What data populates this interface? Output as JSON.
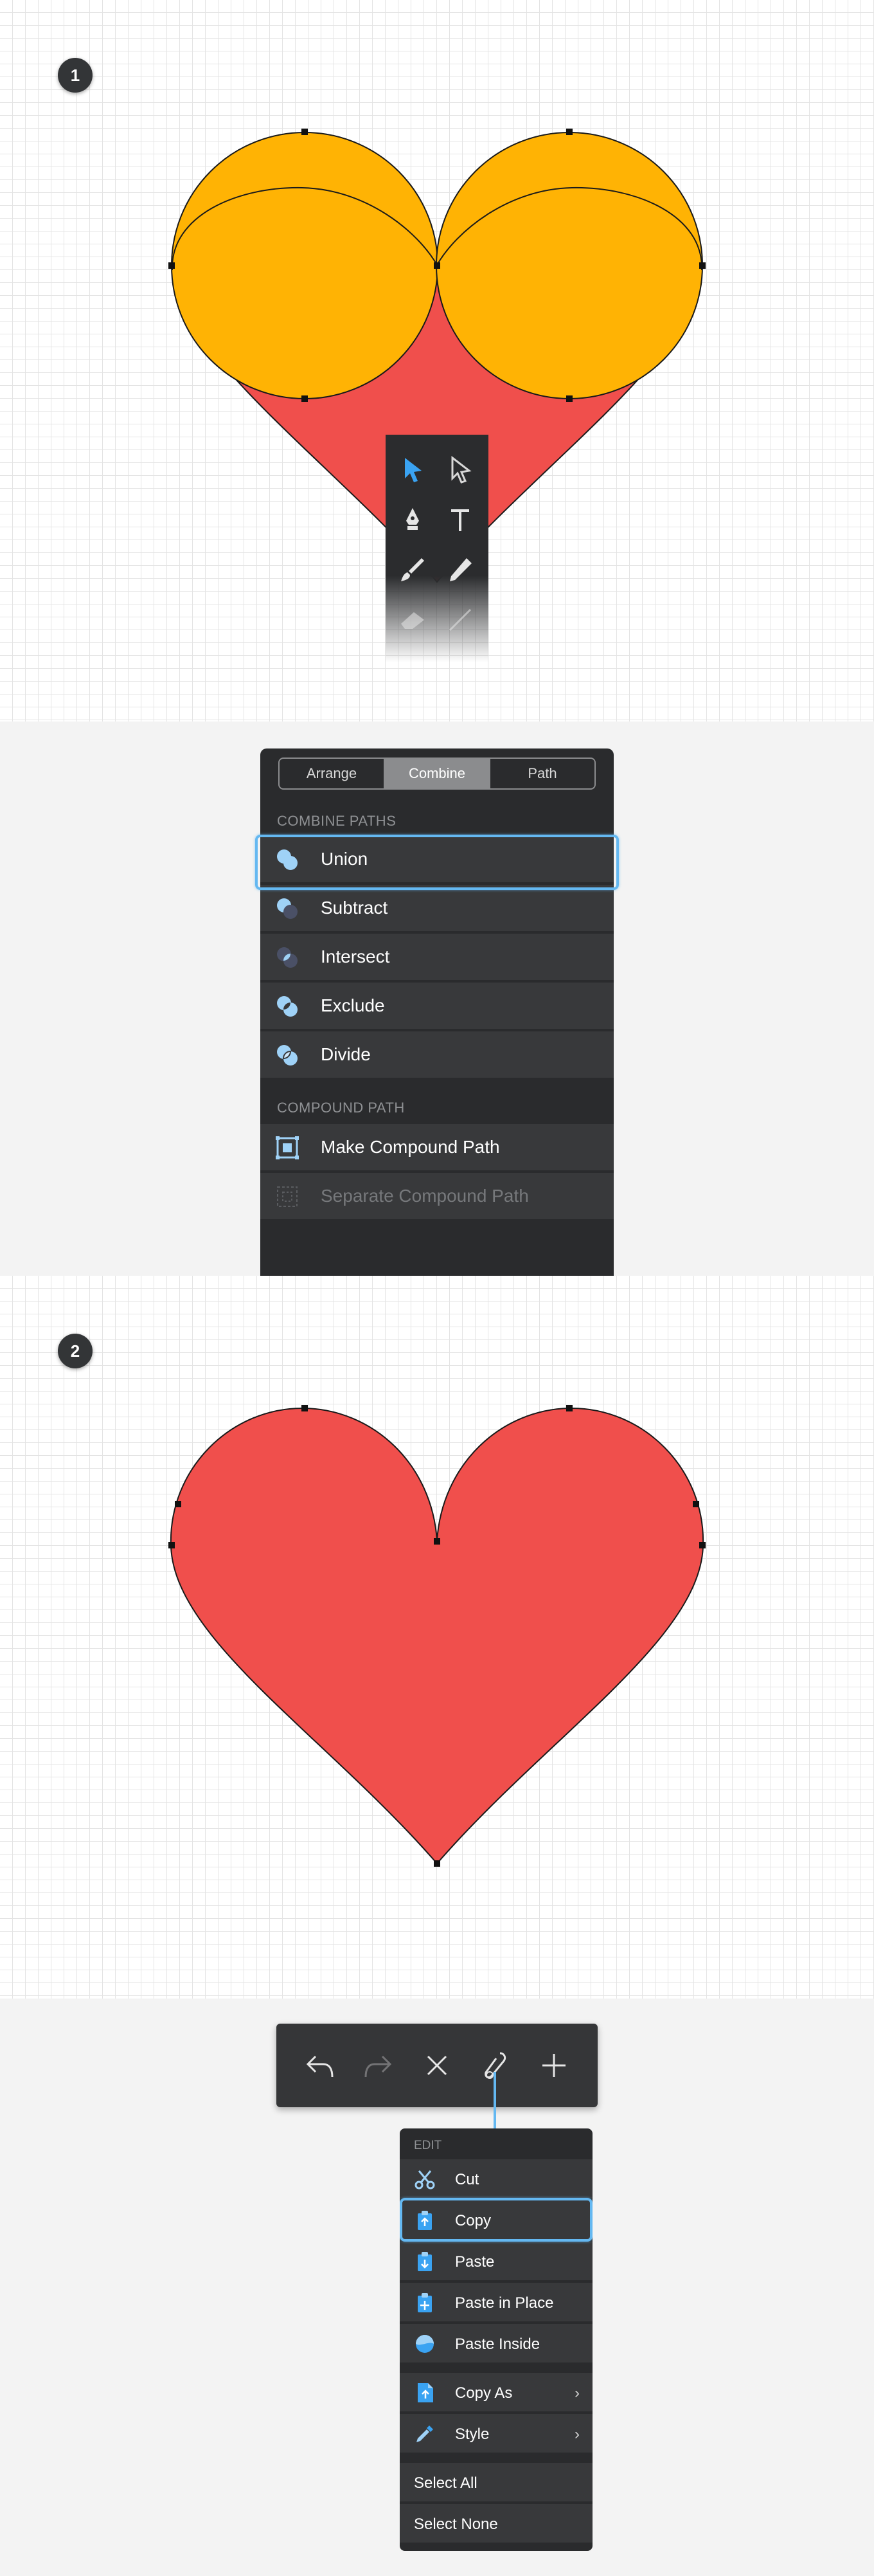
{
  "steps": {
    "step1": "1",
    "step2": "2"
  },
  "colors": {
    "heart_red": "#f04f4c",
    "circle_yellow": "#ffb304",
    "accent_blue": "#64b8f1",
    "panel_dark": "#2a2b2d",
    "row_gray": "#38393b"
  },
  "tool_palette": {
    "tools": [
      {
        "icon": "select-arrow-icon",
        "active": true
      },
      {
        "icon": "direct-select-arrow-icon",
        "active": false
      },
      {
        "icon": "pen-tool-icon",
        "active": false
      },
      {
        "icon": "text-tool-icon",
        "active": false
      },
      {
        "icon": "brush-tool-icon",
        "active": false
      },
      {
        "icon": "pencil-tool-icon",
        "active": false
      },
      {
        "icon": "eraser-tool-icon",
        "active": false
      },
      {
        "icon": "line-tool-icon",
        "active": false
      }
    ]
  },
  "combine_panel": {
    "tabs": [
      "Arrange",
      "Combine",
      "Path"
    ],
    "active_tab": "Combine",
    "section_combine": "COMBINE PATHS",
    "section_compound": "COMPOUND PATH",
    "items": [
      {
        "label": "Union",
        "icon": "union-icon",
        "selected": true
      },
      {
        "label": "Subtract",
        "icon": "subtract-icon"
      },
      {
        "label": "Intersect",
        "icon": "intersect-icon"
      },
      {
        "label": "Exclude",
        "icon": "exclude-icon"
      },
      {
        "label": "Divide",
        "icon": "divide-icon"
      }
    ],
    "compound_items": [
      {
        "label": "Make Compound Path",
        "icon": "make-compound-path-icon",
        "enabled": true
      },
      {
        "label": "Separate Compound Path",
        "icon": "separate-compound-path-icon",
        "enabled": false
      }
    ]
  },
  "action_bar": {
    "buttons": [
      {
        "icon": "undo-icon",
        "enabled": true
      },
      {
        "icon": "redo-icon",
        "enabled": false
      },
      {
        "icon": "delete-icon",
        "enabled": true
      },
      {
        "icon": "clip-icon",
        "enabled": true,
        "active": true
      },
      {
        "icon": "add-icon",
        "enabled": true
      }
    ]
  },
  "edit_menu": {
    "heading": "EDIT",
    "items": [
      {
        "label": "Cut",
        "icon": "scissors-icon"
      },
      {
        "label": "Copy",
        "icon": "copy-icon",
        "selected": true
      },
      {
        "label": "Paste",
        "icon": "paste-icon"
      },
      {
        "label": "Paste in Place",
        "icon": "paste-in-place-icon"
      },
      {
        "label": "Paste Inside",
        "icon": "paste-inside-icon"
      }
    ],
    "submenu_items": [
      {
        "label": "Copy As",
        "icon": "copy-as-icon",
        "chevron": "›"
      },
      {
        "label": "Style",
        "icon": "eyedropper-icon",
        "chevron": "›"
      }
    ],
    "select_items": [
      {
        "label": "Select All"
      },
      {
        "label": "Select None"
      }
    ]
  }
}
